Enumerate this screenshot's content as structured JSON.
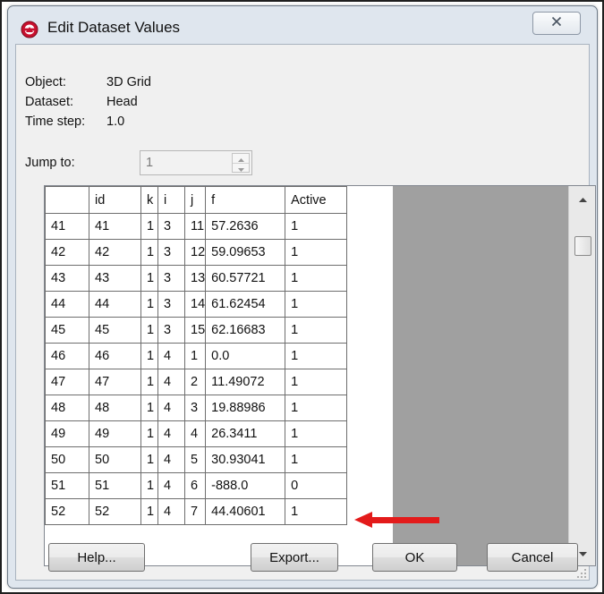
{
  "window": {
    "title": "Edit Dataset Values",
    "app_icon": "app-logo-icon",
    "close_icon": "close-icon"
  },
  "info": {
    "object_label": "Object:",
    "object_value": "3D Grid",
    "dataset_label": "Dataset:",
    "dataset_value": "Head",
    "timestep_label": "Time step:",
    "timestep_value": "1.0",
    "jump_label": "Jump to:",
    "jump_value": "1"
  },
  "grid": {
    "columns": [
      "",
      "id",
      "k",
      "i",
      "j",
      "f",
      "Active"
    ],
    "rows": [
      [
        "41",
        "41",
        "1",
        "3",
        "11",
        "57.2636",
        "1"
      ],
      [
        "42",
        "42",
        "1",
        "3",
        "12",
        "59.09653",
        "1"
      ],
      [
        "43",
        "43",
        "1",
        "3",
        "13",
        "60.57721",
        "1"
      ],
      [
        "44",
        "44",
        "1",
        "3",
        "14",
        "61.62454",
        "1"
      ],
      [
        "45",
        "45",
        "1",
        "3",
        "15",
        "62.16683",
        "1"
      ],
      [
        "46",
        "46",
        "1",
        "4",
        "1",
        "0.0",
        "1"
      ],
      [
        "47",
        "47",
        "1",
        "4",
        "2",
        "11.49072",
        "1"
      ],
      [
        "48",
        "48",
        "1",
        "4",
        "3",
        "19.88986",
        "1"
      ],
      [
        "49",
        "49",
        "1",
        "4",
        "4",
        "26.3411",
        "1"
      ],
      [
        "50",
        "50",
        "1",
        "4",
        "5",
        "30.93041",
        "1"
      ],
      [
        "51",
        "51",
        "1",
        "4",
        "6",
        "-888.0",
        "0"
      ],
      [
        "52",
        "52",
        "1",
        "4",
        "7",
        "44.40601",
        "1"
      ]
    ],
    "annotation": {
      "type": "red-arrow",
      "color": "#e31b1b",
      "points_to_row": "51"
    }
  },
  "buttons": {
    "help": "Help...",
    "export": "Export...",
    "ok": "OK",
    "cancel": "Cancel"
  },
  "colors": {
    "window_bg": "#dfe6ee",
    "client_bg": "#f0f0f0",
    "grid_gray": "#a0a0a0",
    "arrow": "#e31b1b"
  }
}
